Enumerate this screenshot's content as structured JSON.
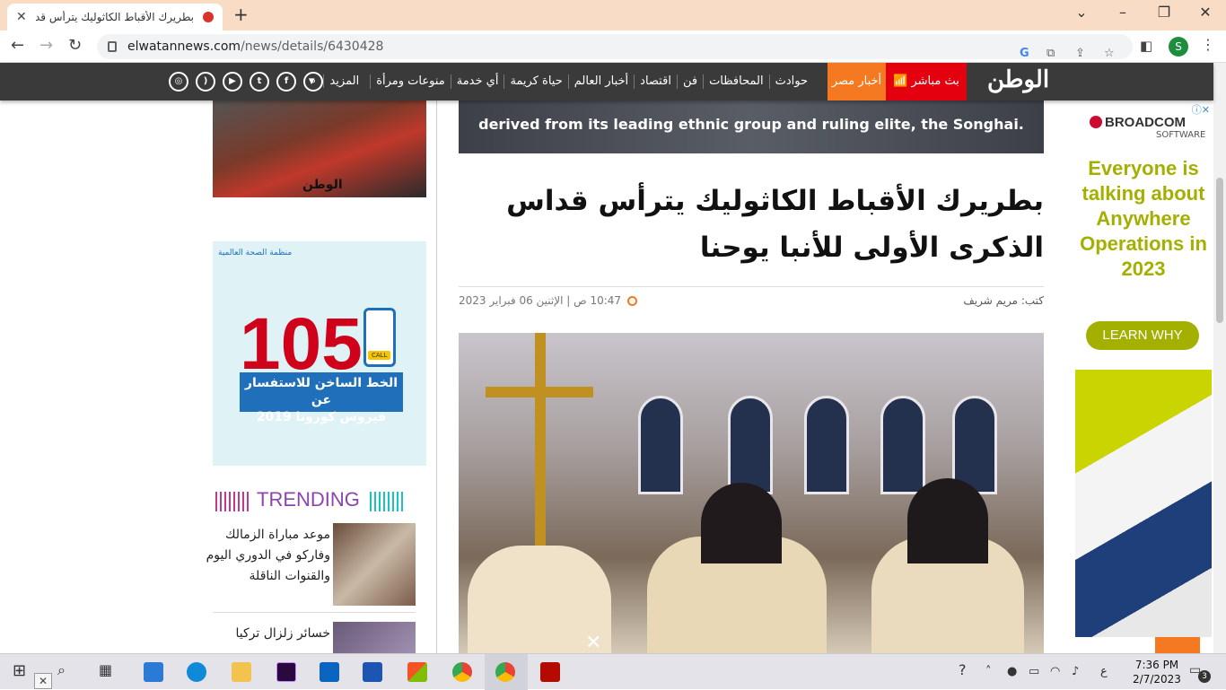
{
  "browser": {
    "tab_title": "بطريرك الأقباط الكاثوليك يترأس قدا",
    "tab_close": "✕",
    "new_tab": "+",
    "url_domain": "elwatannews.com",
    "url_path": "/news/details/6430428",
    "profile_initial": "S"
  },
  "site_nav": {
    "logo": "الوطن",
    "live": "بث مباشر",
    "egypt_news": "أخبار مصر",
    "menu": [
      "حوادث",
      "المحافظات",
      "فن",
      "اقتصاد",
      "أخبار العالم",
      "حياة كريمة",
      "أي خدمة",
      "منوعات ومرأة",
      "المزيد"
    ],
    "social_icons": [
      "search-icon",
      "facebook-icon",
      "twitter-icon",
      "youtube-icon",
      "rss-icon",
      "instagram-icon"
    ]
  },
  "sidebar": {
    "hug_logo": "الوطن",
    "covid_ad": {
      "number": "105",
      "line1": "الخط الساخن للاستفسار عن",
      "line2": "فيروس كورونا 2019",
      "call": "CALL",
      "org": "منظمة الصحة العالمية"
    },
    "trending_label": "TRENDING",
    "trending": [
      {
        "title": "موعد مباراة الزمالك وفاركو في الدوري اليوم والقنوات الناقلة"
      },
      {
        "title": "خسائر زلزال تركيا"
      }
    ]
  },
  "article": {
    "top_image_caption": "derived from its leading ethnic group and ruling elite, the Songhai.",
    "headline": "بطريرك الأقباط الكاثوليك يترأس قداس الذكرى الأولى للأنبا يوحنا",
    "author_label": "كتب:",
    "author": "مريم شريف",
    "date": "10:47 ص | الإثنين 06 فبراير 2023",
    "close_overlay": "✕"
  },
  "ad": {
    "brand": "BROADCOM",
    "brand_sub": "SOFTWARE",
    "headline": "Everyone is talking about Anywhere Operations in 2023",
    "cta": "LEARN WHY",
    "info": "ⓘ✕"
  },
  "taskbar": {
    "time": "7:36 PM",
    "date": "2/7/2023",
    "lang": "ع",
    "notifications": "3"
  }
}
